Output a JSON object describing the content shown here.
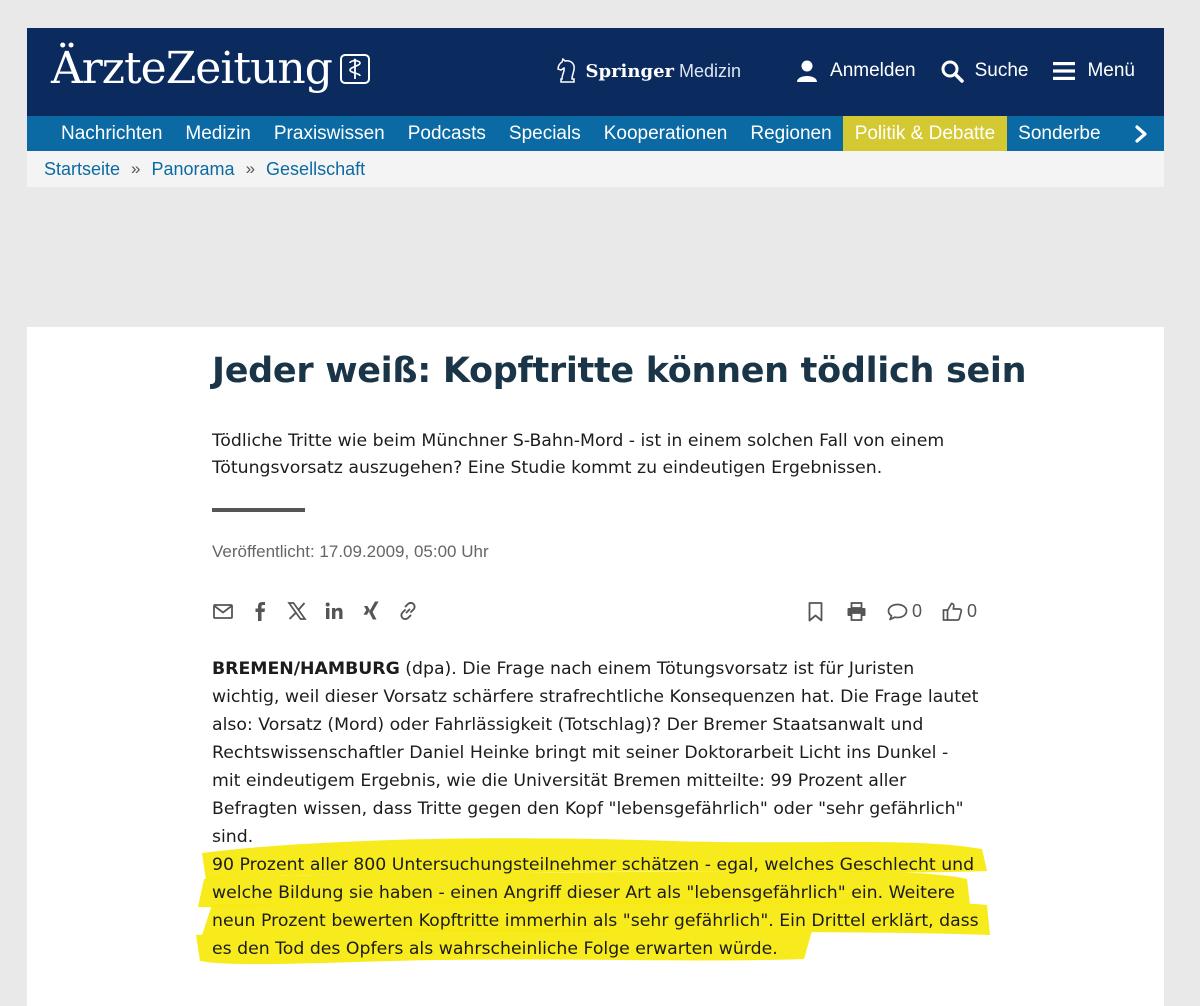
{
  "header": {
    "logo_text": "ÄrzteZeitung",
    "springer_brand": "Springer",
    "springer_sub": "Medizin",
    "login_label": "Anmelden",
    "search_label": "Suche",
    "menu_label": "Menü"
  },
  "nav": {
    "items": [
      {
        "label": "Nachrichten"
      },
      {
        "label": "Medizin"
      },
      {
        "label": "Praxiswissen"
      },
      {
        "label": "Podcasts"
      },
      {
        "label": "Specials"
      },
      {
        "label": "Kooperationen"
      },
      {
        "label": "Regionen"
      },
      {
        "label": "Politik & Debatte",
        "active": true
      },
      {
        "label": "Sonderbe"
      }
    ],
    "active_color": "#d4c833"
  },
  "breadcrumb": {
    "items": [
      "Startseite",
      "Panorama",
      "Gesellschaft"
    ],
    "separator": "»"
  },
  "article": {
    "title": "Jeder weiß: Kopftritte können tödlich sein",
    "teaser": "Tödliche Tritte wie beim Münchner S-Bahn-Mord - ist in einem solchen Fall von einem Tötungsvorsatz auszugehen? Eine Studie kommt zu eindeutigen Ergebnissen.",
    "published": "Veröffentlicht: 17.09.2009, 05:00 Uhr",
    "comments_count": "0",
    "likes_count": "0",
    "dateline": "BREMEN/HAMBURG",
    "paragraph1": " (dpa). Die Frage nach einem Tötungsvorsatz ist für Juristen wichtig, weil dieser Vorsatz schärfere strafrechtliche Konsequenzen hat. Die Frage lautet also: Vorsatz (Mord) oder Fahrlässigkeit (Totschlag)? Der Bremer Staatsanwalt und Rechtswissenschaftler Daniel Heinke bringt mit seiner Doktorarbeit Licht ins Dunkel - mit eindeutigem Ergebnis, wie die Universität Bremen mitteilte: 99 Prozent aller Befragten wissen, dass Tritte gegen den Kopf \"lebensgefährlich\" oder \"sehr gefährlich\" sind.",
    "paragraph2": "90 Prozent aller 800 Untersuchungsteilnehmer schätzen - egal, welches Geschlecht und welche Bildung sie haben - einen Angriff dieser Art als \"lebensgefährlich\" ein. Weitere neun Prozent bewerten Kopftritte immerhin als \"sehr gefährlich\". Ein Drittel erklärt, dass es den Tod des Opfers als wahrscheinliche Folge erwarten würde."
  },
  "share_icons": [
    "mail-icon",
    "facebook-icon",
    "x-icon",
    "linkedin-icon",
    "xing-icon",
    "link-icon"
  ],
  "colors": {
    "header_bg": "#0b2b5f",
    "nav_bg": "#0b6aa3",
    "highlight": "#f7ea12"
  }
}
